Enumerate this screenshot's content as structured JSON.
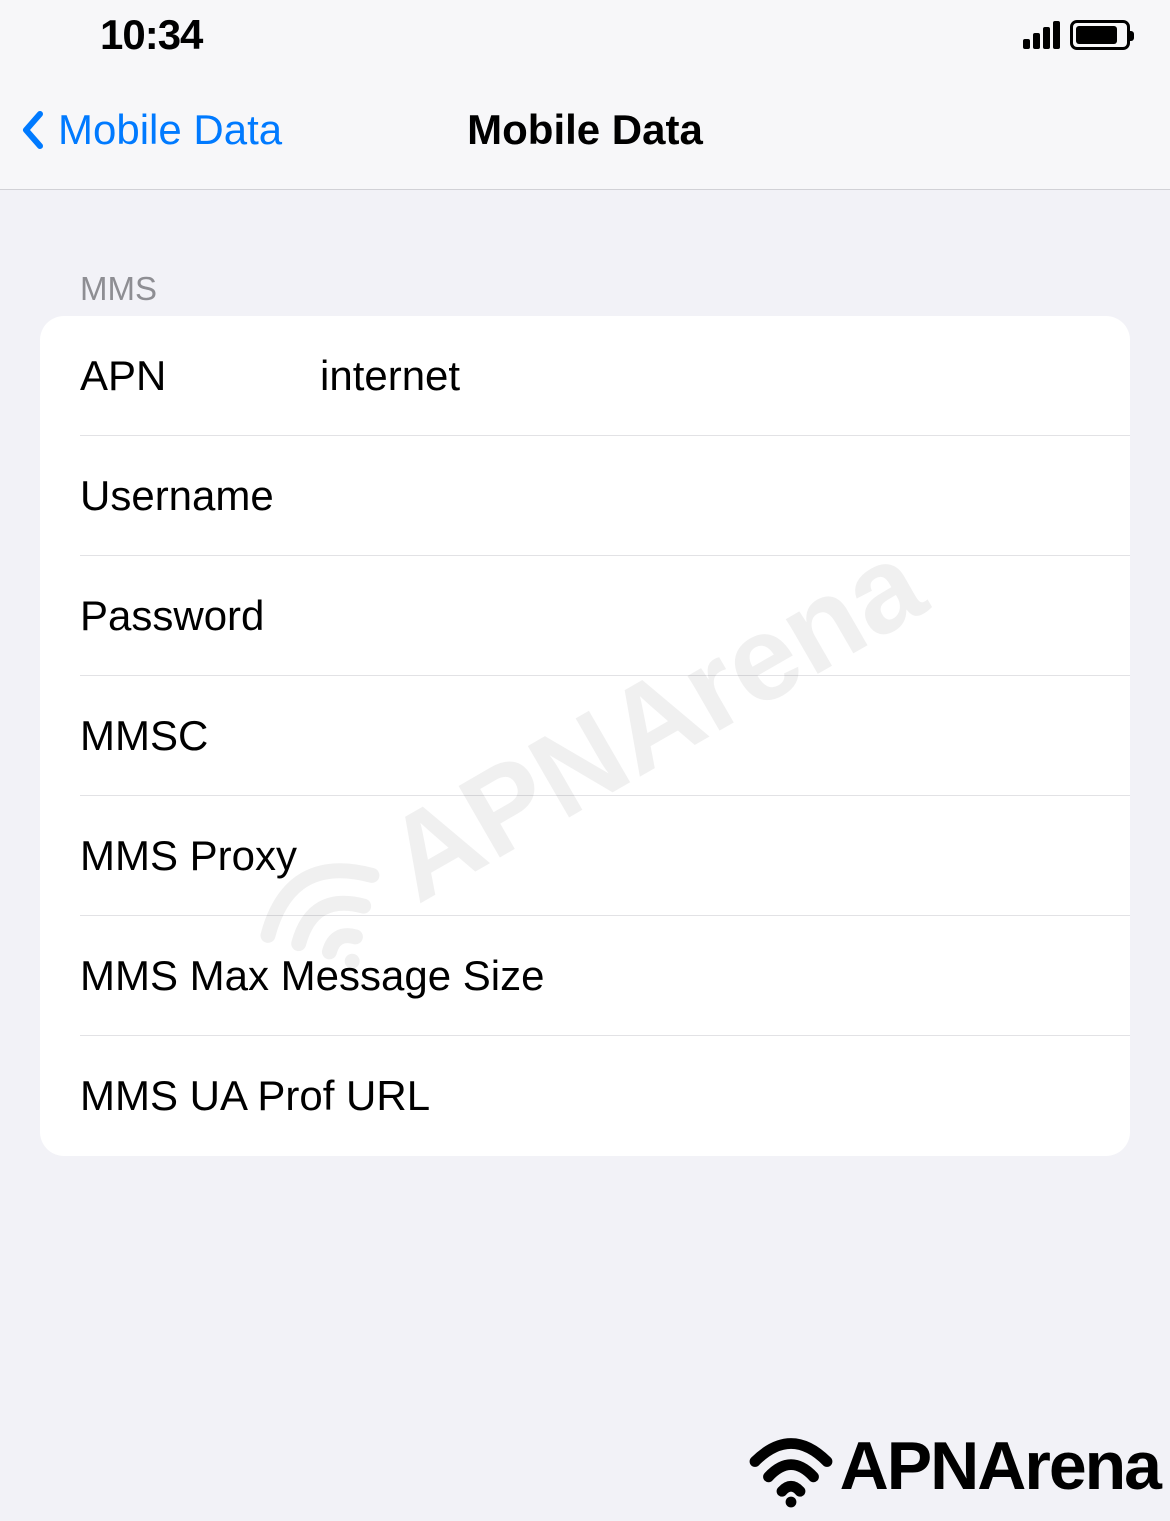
{
  "statusBar": {
    "time": "10:34"
  },
  "nav": {
    "backLabel": "Mobile Data",
    "title": "Mobile Data"
  },
  "section": {
    "header": "MMS",
    "rows": [
      {
        "label": "APN",
        "value": "internet"
      },
      {
        "label": "Username",
        "value": ""
      },
      {
        "label": "Password",
        "value": ""
      },
      {
        "label": "MMSC",
        "value": ""
      },
      {
        "label": "MMS Proxy",
        "value": ""
      },
      {
        "label": "MMS Max Message Size",
        "value": ""
      },
      {
        "label": "MMS UA Prof URL",
        "value": ""
      }
    ]
  },
  "branding": {
    "watermark": "APNArena",
    "footer": "APNArena"
  }
}
